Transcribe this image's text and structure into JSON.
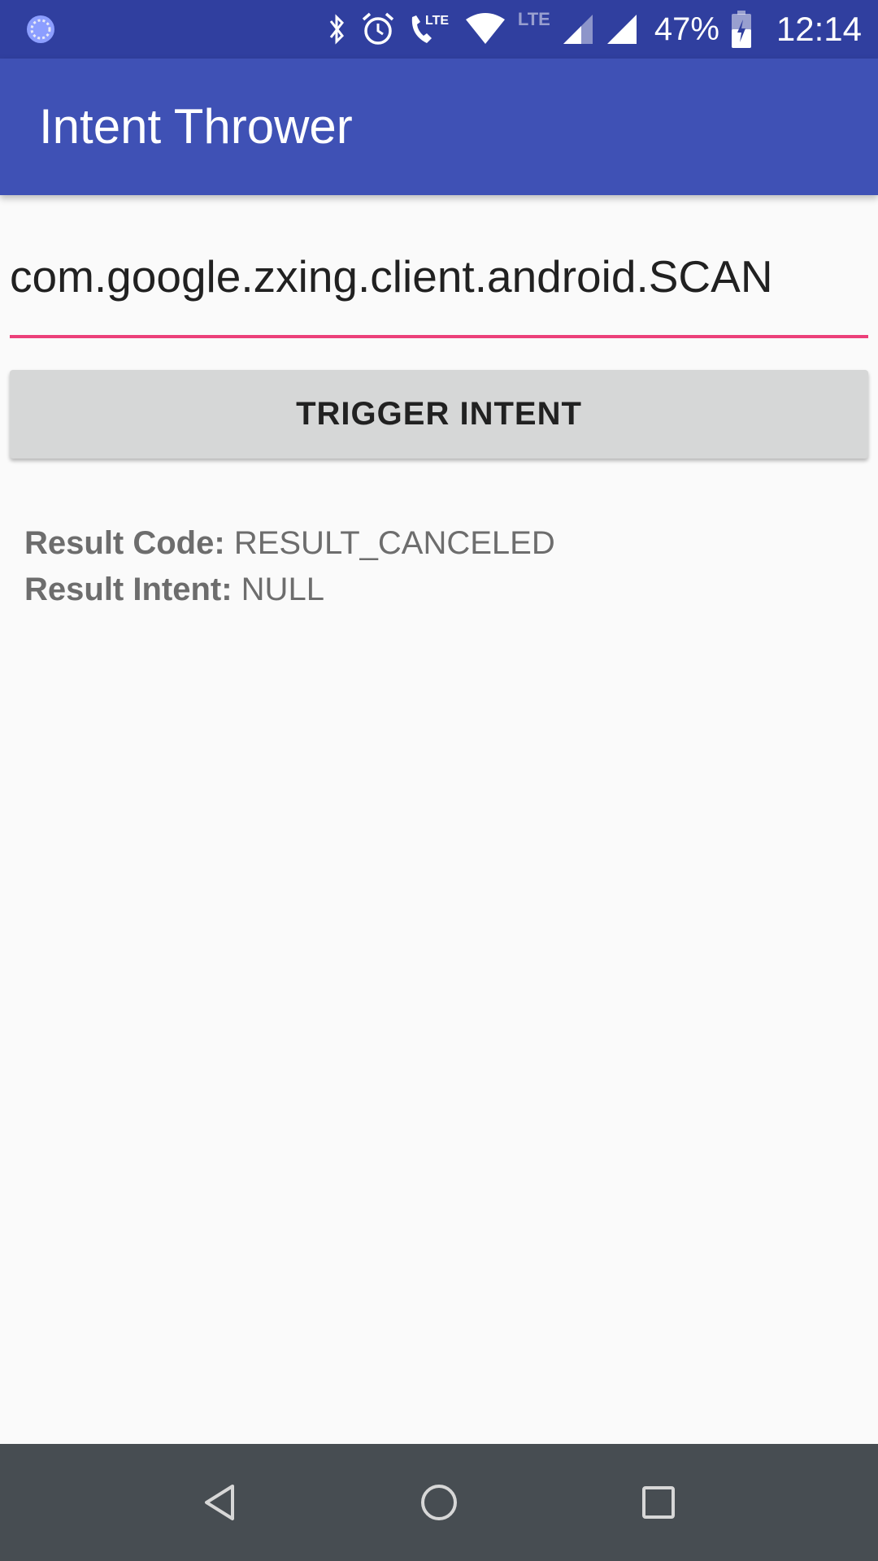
{
  "status_bar": {
    "icons": [
      "notification-circle-icon",
      "bluetooth-icon",
      "alarm-icon",
      "volte-call-icon",
      "wifi-icon",
      "lte-icon",
      "signal-partial-icon",
      "signal-full-icon",
      "battery-charging-icon"
    ],
    "lte_label": "LTE",
    "battery_percent": "47%",
    "time": "12:14"
  },
  "app_bar": {
    "title": "Intent Thrower",
    "color": "#3f51b5",
    "status_color": "#303f9f"
  },
  "intent_input": {
    "value": "com.google.zxing.client.android.SCAN",
    "accent_color": "#ec407a"
  },
  "trigger_button": {
    "label": "TRIGGER INTENT"
  },
  "results": {
    "code_label": "Result Code:",
    "code_value": "RESULT_CANCELED",
    "intent_label": "Result Intent:",
    "intent_value": "NULL"
  },
  "nav_bar": {
    "icons": [
      "back-icon",
      "home-icon",
      "recents-icon"
    ]
  }
}
